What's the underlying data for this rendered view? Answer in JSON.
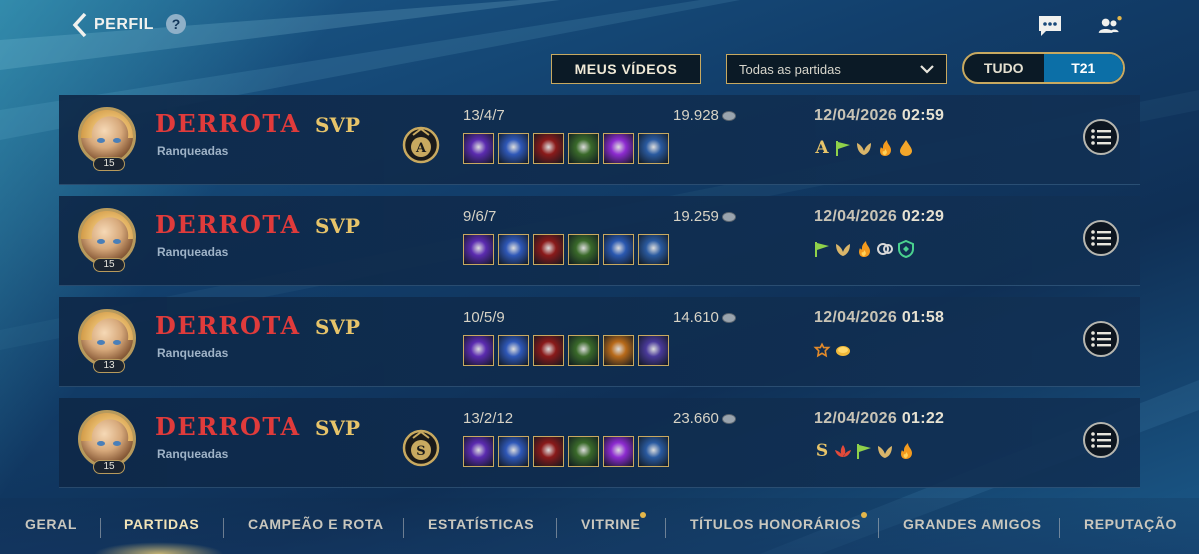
{
  "header": {
    "back_label": "PERFIL",
    "help_label": "?"
  },
  "filters": {
    "videos_button": "MEUS VÍDEOS",
    "match_filter": "Todas as partidas",
    "segments": [
      "TUDO",
      "T21"
    ],
    "active_segment": "T21"
  },
  "matches": [
    {
      "result": "DERROTA",
      "queue": "Ranqueadas",
      "level": "15",
      "tag": "SVP",
      "medal": "A",
      "kda": "13/4/7",
      "gold": "19.928",
      "date": "12/04/2026",
      "time": "02:59",
      "items": [
        "#5b2bb0",
        "#2f58b8",
        "#8a1a1a",
        "#3a6a2a",
        "#8d2bd0",
        "#2a5aa0"
      ],
      "badges": [
        "A",
        "flag",
        "wings",
        "fire",
        "drop"
      ]
    },
    {
      "result": "DERROTA",
      "queue": "Ranqueadas",
      "level": "15",
      "tag": "SVP",
      "medal": "",
      "kda": "9/6/7",
      "gold": "19.259",
      "date": "12/04/2026",
      "time": "02:29",
      "items": [
        "#5b2bb0",
        "#2f58b8",
        "#8a1a1a",
        "#3a6a2a",
        "#2a58b0",
        "#2a5aa0"
      ],
      "badges": [
        "flag",
        "wings",
        "fire",
        "link",
        "shield"
      ]
    },
    {
      "result": "DERROTA",
      "queue": "Ranqueadas",
      "level": "13",
      "tag": "SVP",
      "medal": "",
      "kda": "10/5/9",
      "gold": "14.610",
      "date": "12/04/2026",
      "time": "01:58",
      "items": [
        "#5b2bb0",
        "#2f58b8",
        "#8a1a1a",
        "#3a6a2a",
        "#b86a1a",
        "#4a3a9a"
      ],
      "badges": [
        "crest",
        "coin"
      ]
    },
    {
      "result": "DERROTA",
      "queue": "Ranqueadas",
      "level": "15",
      "tag": "SVP",
      "medal": "S",
      "kda": "13/2/12",
      "gold": "23.660",
      "date": "12/04/2026",
      "time": "01:22",
      "items": [
        "#5b2bb0",
        "#2f58b8",
        "#8a1a1a",
        "#3a6a2a",
        "#8d2bd0",
        "#2a5aa0"
      ],
      "badges": [
        "S",
        "lotus",
        "flag",
        "wings",
        "fire"
      ]
    }
  ],
  "nav": {
    "tabs": [
      "GERAL",
      "PARTIDAS",
      "CAMPEÃO E ROTA",
      "ESTATÍSTICAS",
      "VITRINE",
      "TÍTULOS HONORÁRIOS",
      "GRANDES AMIGOS",
      "REPUTAÇÃO"
    ],
    "active": "PARTIDAS"
  },
  "colors": {
    "accent_gold": "#c8a960",
    "defeat_red": "#e03b3b",
    "active_blue": "#0c6fa7"
  },
  "icons": {
    "back": "chevron-left-icon",
    "chat": "chat-icon",
    "friends": "friends-icon",
    "menu": "list-menu-icon",
    "dropdown": "chevron-down-icon"
  }
}
